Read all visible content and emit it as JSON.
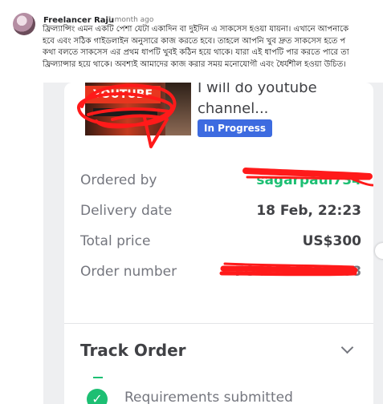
{
  "post": {
    "author": "Freelancer Raju",
    "time": "1 month ago",
    "lines": [
      "ফ্রিল্যান্সিং এমন একটি পেশা যেটা একাদিন বা দুইদিন এ সাকসেস হওয়া যায়না। এখানে আপনাকে",
      "হবে এবং সঠিক গাইডলাইন অনুসারে কাজ করতে হবে। তাহলে আপনি খুব দ্রুত সাকসেস হতে প",
      "কথা বলতে সাকসেস এর প্রথম ধাপটি খুবই কঠিন হয়ে থাকে। যারা এই ধাপটি পার করতে পারে তা",
      "ফ্রিল্যান্সার হয়ে থাকে। অবশ্যই আমাদের কাজ করার সময় মনোযোগী এবং ধৈর্যশীল হওয়া উচিত।"
    ]
  },
  "order": {
    "thumbnail_text": "YOUTUBE",
    "title_lines": [
      "I will do youtube",
      "channel..."
    ],
    "status": "In Progress",
    "rows": [
      {
        "label": "Ordered by",
        "value": "sagarpaul734"
      },
      {
        "label": "Delivery date",
        "value": "18 Feb, 22:23"
      },
      {
        "label": "Total price",
        "value": "US$300"
      },
      {
        "label": "Order number",
        "value": "FO41F1C7E3B08"
      }
    ]
  },
  "track": {
    "title": "Track Order",
    "steps": [
      {
        "label": "Requirements submitted",
        "icon": "check-icon",
        "done": true
      }
    ]
  },
  "colors": {
    "accent": "#1dbf73",
    "badge": "#3d6be0",
    "redact": "#ff1a1a"
  }
}
